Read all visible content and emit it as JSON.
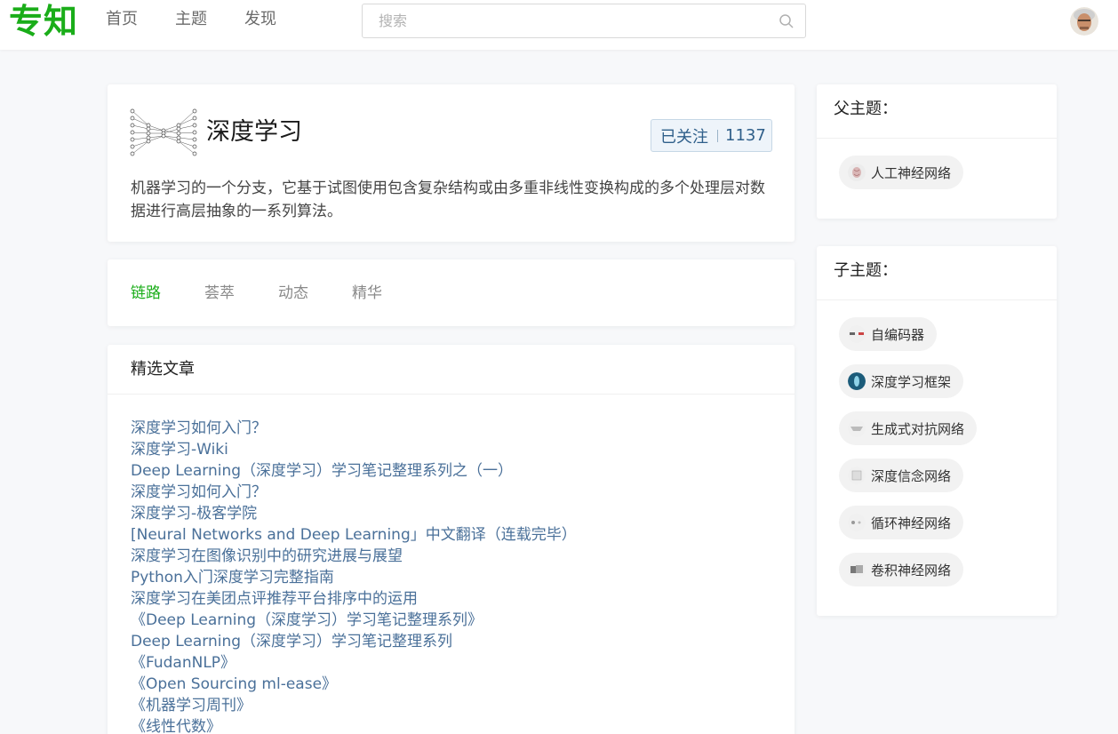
{
  "header": {
    "logo": "专知",
    "nav": [
      "首页",
      "主题",
      "发现"
    ],
    "search_placeholder": "搜索"
  },
  "topic": {
    "title": "深度学习",
    "follow_label": "已关注",
    "follow_count": "1137",
    "description": "机器学习的一个分支，它基于试图使用包含复杂结构或由多重非线性变换构成的多个处理层对数据进行高层抽象的一系列算法。"
  },
  "tabs": [
    "链路",
    "荟萃",
    "动态",
    "精华"
  ],
  "articles": {
    "title": "精选文章",
    "items": [
      "深度学习如何入门？",
      "深度学习-Wiki",
      "Deep Learning（深度学习）学习笔记整理系列之（一）",
      "深度学习如何入门？",
      "深度学习-极客学院",
      "[Neural Networks and Deep Learning」中文翻译（连载完毕）",
      "深度学习在图像识别中的研究进展与展望",
      "Python入门深度学习完整指南",
      "深度学习在美团点评推荐平台排序中的运用",
      "《Deep Learning（深度学习）学习笔记整理系列》",
      "Deep Learning（深度学习）学习笔记整理系列",
      "《FudanNLP》",
      "《Open Sourcing ml-ease》",
      "《机器学习周刊》",
      "《线性代数》"
    ]
  },
  "parent_topics": {
    "title": "父主题：",
    "items": [
      "人工神经网络"
    ]
  },
  "child_topics": {
    "title": "子主题：",
    "items": [
      "自编码器",
      "深度学习框架",
      "生成式对抗网络",
      "深度信念网络",
      "循环神经网络",
      "卷积神经网络"
    ]
  },
  "colors": {
    "brand": "#1aad19",
    "link": "#4a7099",
    "follow_bg": "#eef4fa"
  }
}
